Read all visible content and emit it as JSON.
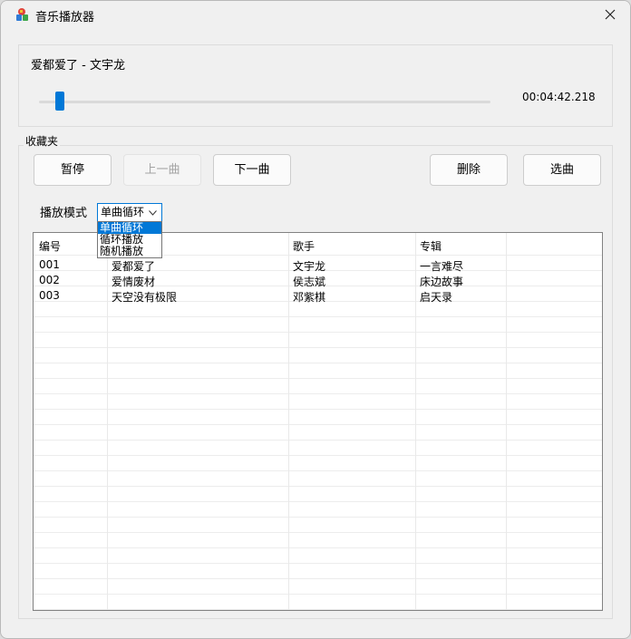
{
  "window": {
    "title": "音乐播放器",
    "icon": "music-app-icon"
  },
  "now_playing": {
    "song": "爱都爱了 - 文宇龙",
    "time": "00:04:42.218",
    "progress": 0.046
  },
  "favorites": {
    "group_label": "收藏夹",
    "buttons": {
      "pause": "暂停",
      "prev": "上一曲",
      "next": "下一曲",
      "delete": "删除",
      "select": "选曲"
    },
    "mode_label": "播放模式",
    "mode_value": "单曲循环",
    "mode_options": [
      "单曲循环",
      "循环播放",
      "随机播放"
    ],
    "columns": [
      "编号",
      "",
      "歌手",
      "专辑"
    ],
    "rows": [
      {
        "id": "001",
        "title": "爱都爱了",
        "artist": "文宇龙",
        "album": "一言难尽"
      },
      {
        "id": "002",
        "title": "爱情废材",
        "artist": "侯志斌",
        "album": "床边故事"
      },
      {
        "id": "003",
        "title": "天空没有极限",
        "artist": "邓紫棋",
        "album": "启天录"
      }
    ]
  },
  "colors": {
    "accent": "#0078d7",
    "window_bg": "#f0f0f0",
    "table_border": "#828282"
  }
}
